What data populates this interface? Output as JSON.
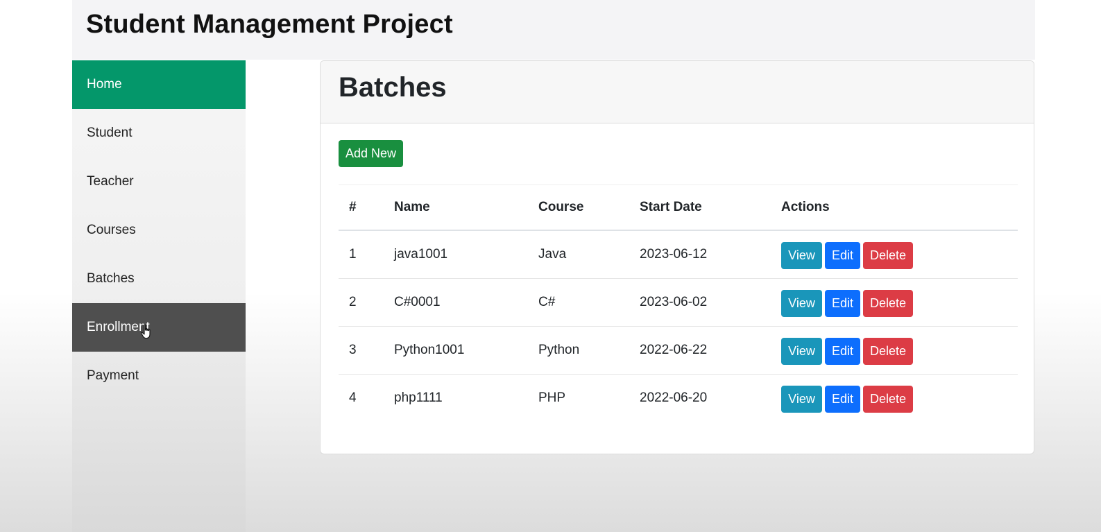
{
  "header": {
    "title": "Student Management Project"
  },
  "sidebar": {
    "items": [
      {
        "label": "Home"
      },
      {
        "label": "Student"
      },
      {
        "label": "Teacher"
      },
      {
        "label": "Courses"
      },
      {
        "label": "Batches"
      },
      {
        "label": "Enrollment"
      },
      {
        "label": "Payment"
      }
    ]
  },
  "main": {
    "title": "Batches",
    "add_button": "Add New",
    "table": {
      "headers": [
        "#",
        "Name",
        "Course",
        "Start Date",
        "Actions"
      ],
      "rows": [
        {
          "num": "1",
          "name": "java1001",
          "course": "Java",
          "start": "2023-06-12"
        },
        {
          "num": "2",
          "name": "C#0001",
          "course": "C#",
          "start": "2023-06-02"
        },
        {
          "num": "3",
          "name": "Python1001",
          "course": "Python",
          "start": "2022-06-22"
        },
        {
          "num": "4",
          "name": "php1111",
          "course": "PHP",
          "start": "2022-06-20"
        }
      ],
      "actions": {
        "view": "View",
        "edit": "Edit",
        "delete": "Delete"
      }
    }
  },
  "colors": {
    "active_nav": "#04976a",
    "hover_nav": "#4f4f4f",
    "add_button": "#198f3f",
    "view_button": "#1a96ba",
    "edit_button": "#0d6efd",
    "delete_button": "#dc3c45"
  }
}
